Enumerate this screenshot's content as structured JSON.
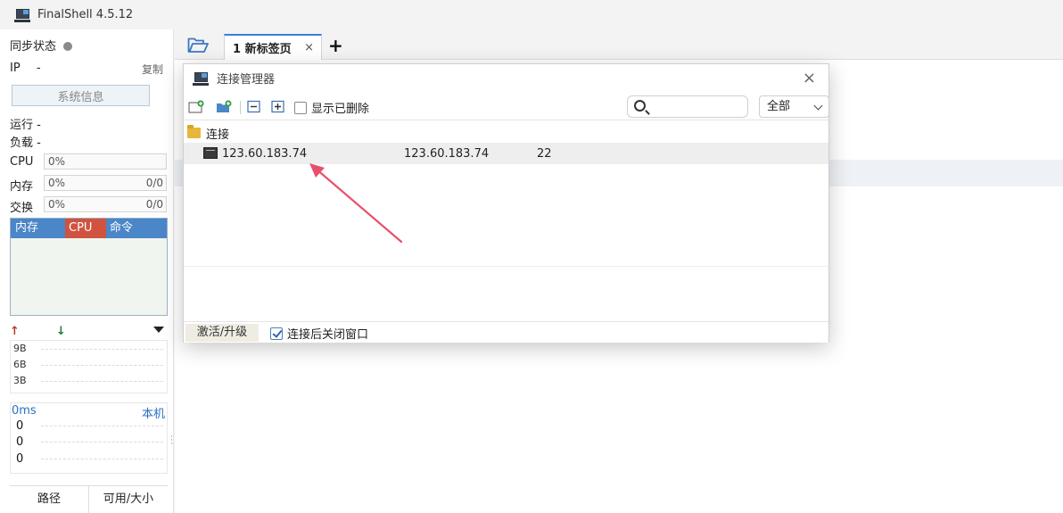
{
  "window": {
    "title": "FinalShell 4.5.12"
  },
  "left_panel": {
    "sync_label": "同步状态",
    "ip_label": "IP",
    "ip_value": "-",
    "copy_label": "复制",
    "sysinfo_button": "系统信息",
    "uptime_label": "运行 -",
    "load_label": "负载 -",
    "cpu": {
      "label": "CPU",
      "percent": "0%"
    },
    "memory": {
      "label": "内存",
      "percent": "0%",
      "ratio": "0/0"
    },
    "swap": {
      "label": "交换",
      "percent": "0%",
      "ratio": "0/0"
    },
    "process_columns": [
      "内存",
      "CPU",
      "命令"
    ],
    "network": {
      "ticks": [
        "9B",
        "6B",
        "3B"
      ]
    },
    "ping": {
      "latency": "0ms",
      "target": "本机",
      "values": [
        "0",
        "0",
        "0"
      ]
    },
    "bottom_tabs": [
      "路径",
      "可用/大小"
    ]
  },
  "tabs": [
    {
      "label": "1 新标签页",
      "close": "×"
    }
  ],
  "new_tab_label": "+",
  "dialog": {
    "title": "连接管理器",
    "close": "×",
    "show_deleted_label": "显示已删除",
    "search_placeholder": "",
    "filter_value": "全部",
    "folder_name": "连接",
    "connections": [
      {
        "name": "123.60.183.74",
        "host": "123.60.183.74",
        "port": "22"
      }
    ],
    "activate_label": "激活/升级",
    "close_after_connect_label": "连接后关闭窗口",
    "close_after_connect_checked": true
  },
  "colors": {
    "accent": "#3c7fd8",
    "process_header": "#4a86c8",
    "cpu_header": "#d0533f",
    "annotation_arrow": "#e8506a"
  }
}
